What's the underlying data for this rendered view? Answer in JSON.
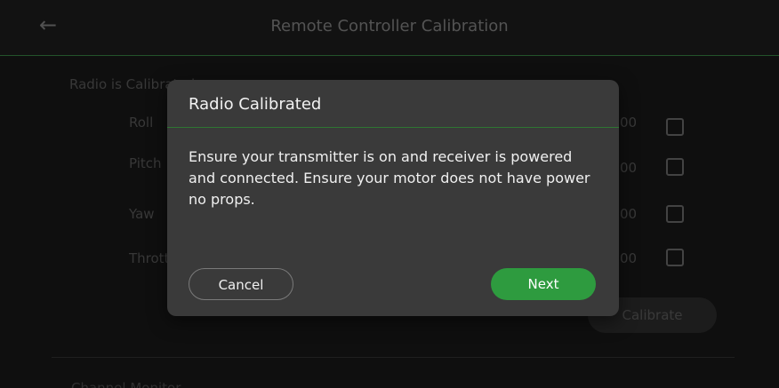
{
  "header": {
    "title": "Remote Controller Calibration",
    "back_icon": "arrow-left-icon"
  },
  "main": {
    "section_title": "Radio is Calibrated",
    "rows": [
      {
        "label": "Roll",
        "value": "00"
      },
      {
        "label": "Pitch",
        "value": "00"
      },
      {
        "label": "Yaw",
        "value": "00"
      },
      {
        "label": "Throttle",
        "value": "00"
      }
    ],
    "calibrate_label": "Calibrate",
    "second_section_title": "Channel Monitor"
  },
  "dialog": {
    "title": "Radio Calibrated",
    "body": "Ensure your transmitter is on and receiver is powered and connected. Ensure your motor does not have power no props.",
    "cancel_label": "Cancel",
    "next_label": "Next"
  },
  "colors": {
    "accent_green": "#2e9b3f",
    "dialog_bg": "#3a3a3a",
    "header_line": "#2f6f3a"
  }
}
